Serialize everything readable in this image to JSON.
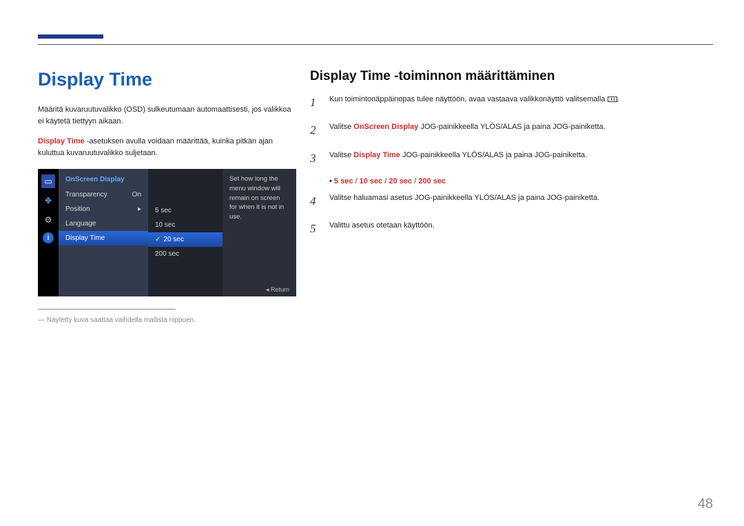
{
  "page_number": "48",
  "left": {
    "title": "Display Time",
    "para1": "Määritä kuvaruutuvalikko (OSD) sulkeutumaan automaattisesti, jos valikkoa ei käytetä tiettyyn aikaan.",
    "para2_lead": "Display Time",
    "para2_rest": " -asetuksen avulla voidaan määrittää, kuinka pitkän ajan kuluttua kuvaruutuvalikko suljetaan.",
    "footnote": "Näytetty kuva saattaa vaihdella mallista riippuen.",
    "osd": {
      "menu_title": "OnScreen Display",
      "rows": [
        {
          "label": "Transparency",
          "value": "On"
        },
        {
          "label": "Position",
          "value": "▸"
        },
        {
          "label": "Language",
          "value": ""
        },
        {
          "label": "Display Time",
          "value": ""
        }
      ],
      "sub": [
        "5 sec",
        "10 sec",
        "20 sec",
        "200 sec"
      ],
      "desc": "Set how long the menu window will remain on screen for when it is not in use.",
      "return": "Return"
    }
  },
  "right": {
    "title": "Display Time -toiminnon määrittäminen",
    "step1": "Kun toimintonäppäinopas tulee näyttöön, avaa vastaava valikkonäyttö valitsemalla ",
    "step2a": "Valitse ",
    "step2b": "OnScreen Display",
    "step2c": " JOG-painikkeella YLÖS/ALAS ja paina JOG-painiketta.",
    "step3a": "Valitse ",
    "step3b": "Display Time",
    "step3c": " JOG-painikkeella YLÖS/ALAS ja paina JOG-painiketta.",
    "options": [
      "5 sec",
      "10 sec",
      "20 sec",
      "200 sec"
    ],
    "step4": "Valitse haluamasi asetus JOG-painikkeella YLÖS/ALAS ja paina JOG-painiketta.",
    "step5": "Valittu asetus otetaan käyttöön."
  }
}
